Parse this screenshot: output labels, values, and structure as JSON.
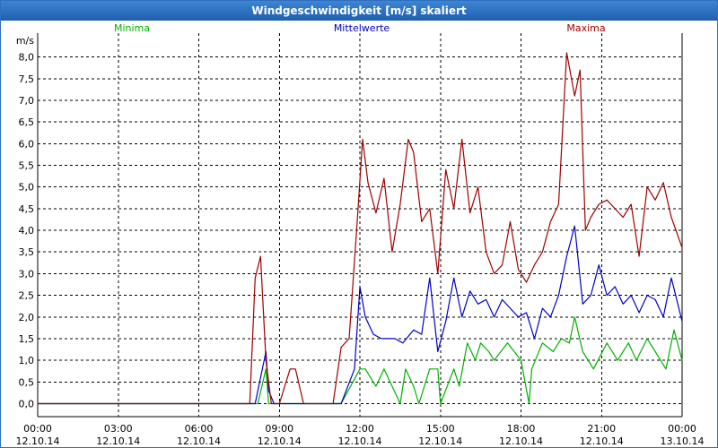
{
  "window": {
    "title": "Windgeschwindigkeit [m/s] skaliert"
  },
  "colors": {
    "min": "#00b000",
    "mean": "#0000c8",
    "max": "#a00000",
    "grid": "#000000",
    "axis": "#000000"
  },
  "chart_data": {
    "type": "line",
    "title": "Windgeschwindigkeit [m/s] skaliert",
    "ylabel": "m/s",
    "ylim": [
      -0.3,
      8.55
    ],
    "xlim": [
      0,
      24
    ],
    "grid": true,
    "legend_position": "top",
    "y_ticks": [
      "0,0",
      "0,5",
      "1,0",
      "1,5",
      "2,0",
      "2,5",
      "3,0",
      "3,5",
      "4,0",
      "4,5",
      "5,0",
      "5,5",
      "6,0",
      "6,5",
      "7,0",
      "7,5",
      "8,0"
    ],
    "x_ticks": [
      {
        "time": "00:00",
        "date": "12.10.14"
      },
      {
        "time": "03:00",
        "date": "12.10.14"
      },
      {
        "time": "06:00",
        "date": "12.10.14"
      },
      {
        "time": "09:00",
        "date": "12.10.14"
      },
      {
        "time": "12:00",
        "date": "12.10.14"
      },
      {
        "time": "15:00",
        "date": "12.10.14"
      },
      {
        "time": "18:00",
        "date": "12.10.14"
      },
      {
        "time": "21:00",
        "date": "12.10.14"
      },
      {
        "time": "00:00",
        "date": "13.10.14"
      }
    ],
    "series": [
      {
        "name": "Minima",
        "x": [
          0,
          8.2,
          8.5,
          8.6,
          8.8,
          9.2,
          11.3,
          12.0,
          12.2,
          12.6,
          12.9,
          13.5,
          13.7,
          14.0,
          14.2,
          14.6,
          14.9,
          15.0,
          15.5,
          15.7,
          16.0,
          16.3,
          16.5,
          16.8,
          17.0,
          17.5,
          18.0,
          18.3,
          18.4,
          18.8,
          19.2,
          19.5,
          19.8,
          20.0,
          20.3,
          20.7,
          21.2,
          21.6,
          22.0,
          22.3,
          22.7,
          23.0,
          23.4,
          23.7,
          24.0
        ],
        "values": [
          0,
          0,
          0.8,
          0,
          0,
          0,
          0,
          0.8,
          0.8,
          0.4,
          0.8,
          0,
          0.8,
          0.4,
          0,
          0.8,
          0.8,
          0,
          0.8,
          0.4,
          1.4,
          1.0,
          1.4,
          1.2,
          1.0,
          1.4,
          1.0,
          0,
          0.8,
          1.4,
          1.2,
          1.5,
          1.4,
          2.0,
          1.2,
          0.8,
          1.4,
          1.0,
          1.4,
          1.0,
          1.5,
          1.2,
          0.8,
          1.7,
          1.0
        ]
      },
      {
        "name": "Mittelwerte",
        "x": [
          0,
          8.1,
          8.3,
          8.5,
          8.6,
          8.8,
          9.2,
          11.3,
          11.8,
          12.0,
          12.2,
          12.5,
          12.8,
          13.3,
          13.6,
          14.0,
          14.3,
          14.6,
          14.9,
          15.2,
          15.5,
          15.8,
          16.1,
          16.4,
          16.7,
          17.0,
          17.3,
          17.6,
          17.9,
          18.2,
          18.5,
          18.8,
          19.1,
          19.4,
          19.7,
          20.0,
          20.3,
          20.6,
          20.9,
          21.2,
          21.5,
          21.8,
          22.1,
          22.4,
          22.7,
          23.0,
          23.3,
          23.6,
          24.0
        ],
        "values": [
          0,
          0,
          0.6,
          1.2,
          0.3,
          0,
          0,
          0,
          0.8,
          2.7,
          2.0,
          1.6,
          1.5,
          1.5,
          1.4,
          1.7,
          1.6,
          2.9,
          1.2,
          1.9,
          2.9,
          2.0,
          2.6,
          2.3,
          2.4,
          2.0,
          2.4,
          2.2,
          2.0,
          2.1,
          1.5,
          2.2,
          2.0,
          2.5,
          3.4,
          4.1,
          2.3,
          2.5,
          3.2,
          2.5,
          2.7,
          2.3,
          2.5,
          2.1,
          2.5,
          2.4,
          2.0,
          2.9,
          1.9
        ]
      },
      {
        "name": "Maxima",
        "x": [
          0,
          7.9,
          8.1,
          8.3,
          8.5,
          8.7,
          9.0,
          9.4,
          9.6,
          9.9,
          10.1,
          11.0,
          11.3,
          11.6,
          11.9,
          12.1,
          12.3,
          12.6,
          12.9,
          13.2,
          13.5,
          13.8,
          14.0,
          14.3,
          14.6,
          14.9,
          15.2,
          15.5,
          15.8,
          16.1,
          16.4,
          16.7,
          17.0,
          17.3,
          17.6,
          17.9,
          18.2,
          18.5,
          18.8,
          19.1,
          19.4,
          19.7,
          20.0,
          20.2,
          20.4,
          20.6,
          20.9,
          21.2,
          21.5,
          21.8,
          22.1,
          22.4,
          22.7,
          23.0,
          23.3,
          23.6,
          24.0
        ],
        "values": [
          0,
          0,
          2.9,
          3.4,
          1.0,
          0,
          0,
          0.8,
          0.8,
          0,
          0,
          0,
          1.3,
          1.5,
          4.2,
          6.1,
          5.1,
          4.4,
          5.2,
          3.5,
          4.6,
          6.1,
          5.8,
          4.2,
          4.5,
          3.0,
          5.4,
          4.5,
          6.1,
          4.4,
          5.0,
          3.5,
          3.0,
          3.2,
          4.2,
          3.1,
          2.8,
          3.2,
          3.5,
          4.2,
          4.6,
          8.1,
          7.1,
          7.7,
          4.0,
          4.3,
          4.6,
          4.7,
          4.5,
          4.3,
          4.6,
          3.4,
          5.0,
          4.7,
          5.1,
          4.3,
          3.6
        ]
      }
    ]
  }
}
